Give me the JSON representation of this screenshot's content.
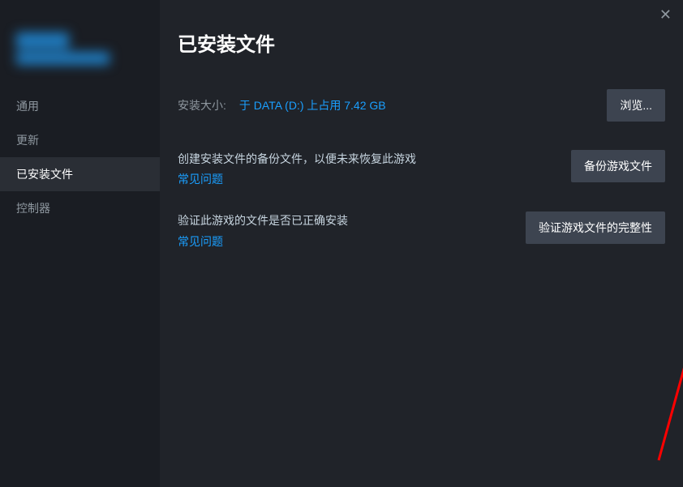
{
  "sidebar": {
    "items": [
      {
        "label": "通用"
      },
      {
        "label": "更新"
      },
      {
        "label": "已安装文件"
      },
      {
        "label": "控制器"
      }
    ],
    "activeIndex": 2
  },
  "main": {
    "title": "已安装文件",
    "install": {
      "sizeLabel": "安装大小:",
      "sizeValue": "于 DATA (D:) 上占用 7.42 GB",
      "browseBtn": "浏览..."
    },
    "backup": {
      "desc": "创建安装文件的备份文件，以便未来恢复此游戏",
      "faq": "常见问题",
      "btn": "备份游戏文件"
    },
    "verify": {
      "desc": "验证此游戏的文件是否已正确安装",
      "faq": "常见问题",
      "btn": "验证游戏文件的完整性"
    }
  }
}
